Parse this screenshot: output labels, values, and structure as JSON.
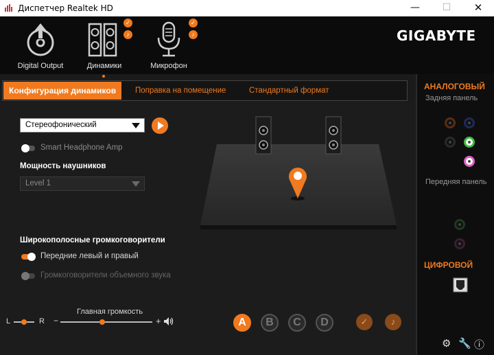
{
  "window": {
    "title": "Диспетчер Realtek HD",
    "minimize": "—",
    "maximize": "☐",
    "close": "✕"
  },
  "devices": [
    {
      "label": "Digital Output",
      "icon": "digital-output-icon"
    },
    {
      "label": "Динамики",
      "icon": "speakers-icon",
      "selected": true
    },
    {
      "label": "Микрофон",
      "icon": "microphone-icon"
    }
  ],
  "brand": "GIGABYTE",
  "tabs": [
    "Конфигурация динамиков",
    "Поправка на помещение",
    "Стандартный формат"
  ],
  "config": {
    "speaker_config": "Стереофонический",
    "smart_headphone": "Smart Headphone Amp",
    "headphone_power_label": "Мощность наушников",
    "headphone_level": "Level 1",
    "wideband_label": "Широкополосные громкоговорители",
    "front_lr": "Передние левый и правый",
    "surround": "Громкоговорители объемного звука"
  },
  "volume": {
    "label": "Главная громкость",
    "balance_left": "L",
    "balance_right": "R",
    "minus": "−",
    "plus": "+",
    "balance_level": 0.5,
    "main_level": 0.5
  },
  "letters": [
    "A",
    "B",
    "C",
    "D"
  ],
  "right_panel": {
    "analog": "АНАЛОГОВЫЙ",
    "back_panel": "Задняя панель",
    "front_panel": "Передняя панель",
    "digital": "ЦИФРОВОЙ"
  },
  "colors": {
    "accent": "#f07a1f",
    "background": "#1c1c1c",
    "jack_green": "#3fbf3f",
    "jack_pink": "#e060c0"
  }
}
